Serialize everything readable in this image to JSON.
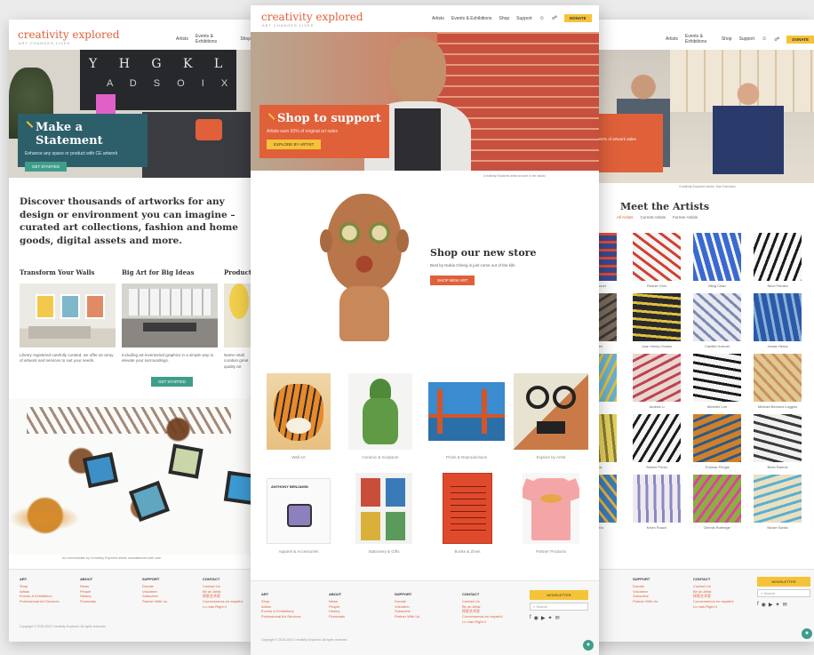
{
  "brand": {
    "name": "creativity explored",
    "tagline": "ART CHANGES LIVES"
  },
  "nav": {
    "artists": "Artists",
    "events": "Events & Exhibitions",
    "shop": "Shop",
    "support": "Support",
    "donate": "DONATE"
  },
  "left": {
    "hero_title": "Make a Statement",
    "hero_sub": "Enhance any space or product with CE artwork",
    "hero_btn": "GET STARTED",
    "headline": "Discover thousands of artworks for any design or environment you can imagine – curated art collections, fashion and home goods, digital assets and more.",
    "col1_title": "Transform Your Walls",
    "col1_text": "Library registered carefully curated, we offer an array of artwork and services to suit your needs.",
    "col2_title": "Big Art for Big Ideas",
    "col2_text": "Including art-inventoried graphics in a simple way to elevate your surroundings.",
    "col3_title": "Product",
    "col3_text": "Name retail curation great quality art",
    "cta": "GET STARTED",
    "promo_caption": "Art merchandise by Creativity Explored artists manufactured with care.",
    "copyright": "Copyright © 2018-2022 Creativity Explored. All rights reserved."
  },
  "center": {
    "hero_title": "Shop to support",
    "hero_sub": "Artists earn 50% of original art sales",
    "hero_btn": "EXPLORE BY ARTIST",
    "hero_caption": "Creativity Explored artist at work in the studio",
    "store_title": "Shop our new store",
    "store_sub": "Bust by Nubia Cheng is just come out of the kiln",
    "store_btn": "SHOP NEW ART",
    "categories": [
      {
        "label": "Wall Art"
      },
      {
        "label": "Ceramic & Sculpture"
      },
      {
        "label": "Prints & Reproductions"
      },
      {
        "label": "Explore by Artist"
      },
      {
        "label": "Apparel & Accessories"
      },
      {
        "label": "Stationery & Gifts"
      },
      {
        "label": "Books & Zines"
      },
      {
        "label": "Partner Products"
      }
    ],
    "apparel_card_text": "ANTHONY BENJAMIN",
    "newsletter_btn": "NEWSLETTER",
    "search_placeholder": "Search",
    "copyright": "Copyright © 2018-2022 Creativity Explored. All rights reserved."
  },
  "right": {
    "hero_text": "Artists earn 50% of artwork sales",
    "hero_caption": "Creativity Explored studio, San Francisco",
    "title": "Meet the Artists",
    "filters": [
      "All Artists",
      "Current Artists",
      "Former Artists"
    ],
    "artists": [
      "Louis Betancourt",
      "Rodnie Chin",
      "Ming Chan",
      "Nicol Ferrara",
      "Albert Green",
      "Juan Henry Ocasio",
      "Camille Holvoet",
      "Jessie Henry",
      "Sus Jue",
      "Andrea Li",
      "Michelle Lee",
      "Michael Bernard Loggins",
      "Ana Molina",
      "Selene Perez",
      "Thomas Pringle",
      "Bean Ramos",
      "Laura Ribeiro",
      "Kevin Roach",
      "Dennis Rutledge",
      "Nicole Sarkis"
    ],
    "newsletter_btn": "NEWSLETTER",
    "search_placeholder": "Search"
  },
  "footer": {
    "art_head": "ART",
    "art_items": [
      "Shop",
      "Artists",
      "Events & Exhibitions",
      "Professional Art Services"
    ],
    "about_head": "ABOUT",
    "about_items": [
      "News",
      "People",
      "History",
      "Financials"
    ],
    "support_head": "SUPPORT",
    "support_items": [
      "Donate",
      "Volunteer",
      "Subscribe",
      "Partner With Us"
    ],
    "contact_head": "CONTACT",
    "contact_items": [
      "Contact Us",
      "Be an Artist",
      "探索艺术家",
      "Conversemos en español",
      "Lo más Right it"
    ]
  },
  "colors": {
    "accent": "#e0603a",
    "teal": "#3f9e8a",
    "yellow": "#f6c338"
  }
}
